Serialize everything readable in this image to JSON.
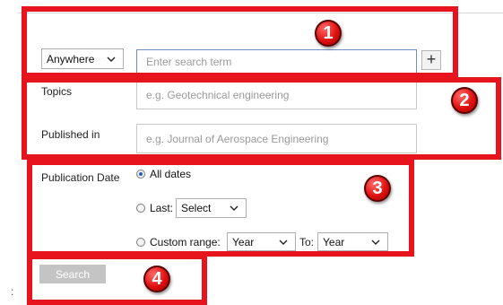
{
  "search": {
    "scope_selected": "Anywhere",
    "term_placeholder": "Enter search term",
    "add_label": "+"
  },
  "filters": {
    "topics_label": "Topics",
    "topics_placeholder": "e.g. Geotechnical engineering",
    "published_label": "Published in",
    "published_placeholder": "e.g. Journal of Aerospace Engineering"
  },
  "publication_date": {
    "label": "Publication Date",
    "all_dates": "All dates",
    "last_label": "Last:",
    "last_selected": "Select",
    "custom_range": "Custom range:",
    "from_selected": "Year",
    "to_label": "To:",
    "to_selected": "Year",
    "selected_option": "all_dates"
  },
  "actions": {
    "search_label": "Search"
  },
  "callouts": [
    "1",
    "2",
    "3",
    "4"
  ],
  "colors": {
    "callout_red": "#e8141d",
    "accent_blue": "#1c63c4",
    "search_button_gray": "#c4c4c4"
  },
  "icons": [
    "chevron-down-icon",
    "plus-icon",
    "radio-icon"
  ],
  "misc": {
    "stray_char": ":"
  }
}
